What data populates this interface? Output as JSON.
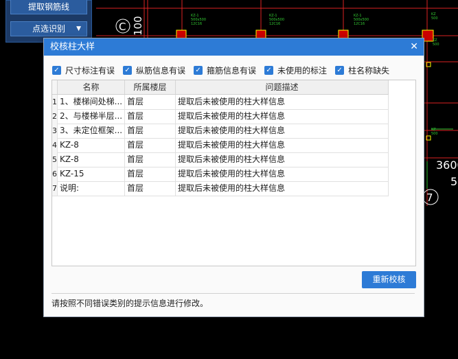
{
  "toolbar": {
    "extract_rebar_label": "提取钢筋线",
    "point_select_label": "点选识别",
    "point_select_caret": "▼"
  },
  "cad": {
    "axis_c_label": "C",
    "axis_7_label": "7",
    "dim_100": "100",
    "dim_3600": "3600",
    "dim_5": "5"
  },
  "dialog": {
    "title": "校核柱大样",
    "close_glyph": "✕",
    "filters": [
      {
        "label": "尺寸标注有误",
        "checked": true
      },
      {
        "label": "纵筋信息有误",
        "checked": true
      },
      {
        "label": "箍筋信息有误",
        "checked": true
      },
      {
        "label": "未使用的标注",
        "checked": true
      },
      {
        "label": "柱名称缺失",
        "checked": true
      }
    ],
    "columns": [
      "名称",
      "所属楼层",
      "问题描述"
    ],
    "rows": [
      {
        "idx": "1",
        "name": "1、楼梯间处梯...",
        "floor": "首层",
        "desc": "提取后未被使用的柱大样信息"
      },
      {
        "idx": "2",
        "name": "2、与楼梯半层...",
        "floor": "首层",
        "desc": "提取后未被使用的柱大样信息"
      },
      {
        "idx": "3",
        "name": "3、未定位框架...",
        "floor": "首层",
        "desc": "提取后未被使用的柱大样信息"
      },
      {
        "idx": "4",
        "name": "KZ-8",
        "floor": "首层",
        "desc": "提取后未被使用的柱大样信息"
      },
      {
        "idx": "5",
        "name": "KZ-8",
        "floor": "首层",
        "desc": "提取后未被使用的柱大样信息"
      },
      {
        "idx": "6",
        "name": "KZ-15",
        "floor": "首层",
        "desc": "提取后未被使用的柱大样信息"
      },
      {
        "idx": "7",
        "name": "说明:",
        "floor": "首层",
        "desc": "提取后未被使用的柱大样信息"
      }
    ],
    "recheck_label": "重新校核",
    "status_text": "请按照不同错误类别的提示信息进行修改。",
    "check_glyph": "✓"
  }
}
